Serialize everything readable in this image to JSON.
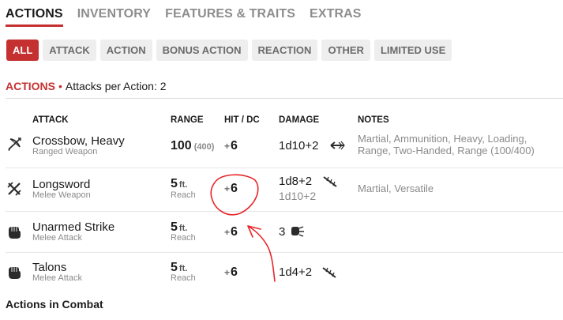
{
  "tabs": [
    {
      "label": "ACTIONS",
      "active": true
    },
    {
      "label": "INVENTORY",
      "active": false
    },
    {
      "label": "FEATURES & TRAITS",
      "active": false
    },
    {
      "label": "EXTRAS",
      "active": false
    }
  ],
  "filters": [
    {
      "label": "ALL",
      "active": true
    },
    {
      "label": "ATTACK",
      "active": false
    },
    {
      "label": "ACTION",
      "active": false
    },
    {
      "label": "BONUS ACTION",
      "active": false
    },
    {
      "label": "REACTION",
      "active": false
    },
    {
      "label": "OTHER",
      "active": false
    },
    {
      "label": "LIMITED USE",
      "active": false
    }
  ],
  "section": {
    "title": "ACTIONS",
    "separator": "•",
    "attacks_per_action": "Attacks per Action: 2"
  },
  "columns": {
    "attack": "ATTACK",
    "range": "RANGE",
    "hit": "HIT / DC",
    "damage": "DAMAGE",
    "notes": "NOTES"
  },
  "attacks": [
    {
      "name": "Crossbow, Heavy",
      "type": "Ranged Weapon",
      "icon": "ranged-weapon-icon",
      "range": "100",
      "range_unit": "",
      "range_long": "(400)",
      "range_sub": "",
      "hit_sign": "+",
      "hit": "6",
      "damage": "1d10+2",
      "damage_alt": "",
      "damage_icon": "piercing-icon",
      "notes": "Martial, Ammunition, Heavy, Loading, Range, Two-Handed, Range (100/400)"
    },
    {
      "name": "Longsword",
      "type": "Melee Weapon",
      "icon": "melee-weapon-icon",
      "range": "5",
      "range_unit": "ft.",
      "range_long": "",
      "range_sub": "Reach",
      "hit_sign": "+",
      "hit": "6",
      "damage": "1d8+2",
      "damage_alt": "1d10+2",
      "damage_icon": "slashing-icon",
      "notes": "Martial, Versatile"
    },
    {
      "name": "Unarmed Strike",
      "type": "Melee Attack",
      "icon": "fist-icon",
      "range": "5",
      "range_unit": "ft.",
      "range_long": "",
      "range_sub": "Reach",
      "hit_sign": "+",
      "hit": "6",
      "damage": "3",
      "damage_alt": "",
      "damage_icon": "bludgeoning-icon",
      "notes": ""
    },
    {
      "name": "Talons",
      "type": "Melee Attack",
      "icon": "fist-icon",
      "range": "5",
      "range_unit": "ft.",
      "range_long": "",
      "range_sub": "Reach",
      "hit_sign": "+",
      "hit": "6",
      "damage": "1d4+2",
      "damage_alt": "",
      "damage_icon": "slashing-icon",
      "notes": ""
    }
  ],
  "footer": {
    "title": "Actions in Combat"
  },
  "colors": {
    "accent": "#c53131",
    "annotation": "#e8262a",
    "muted": "#8a8a8a"
  }
}
